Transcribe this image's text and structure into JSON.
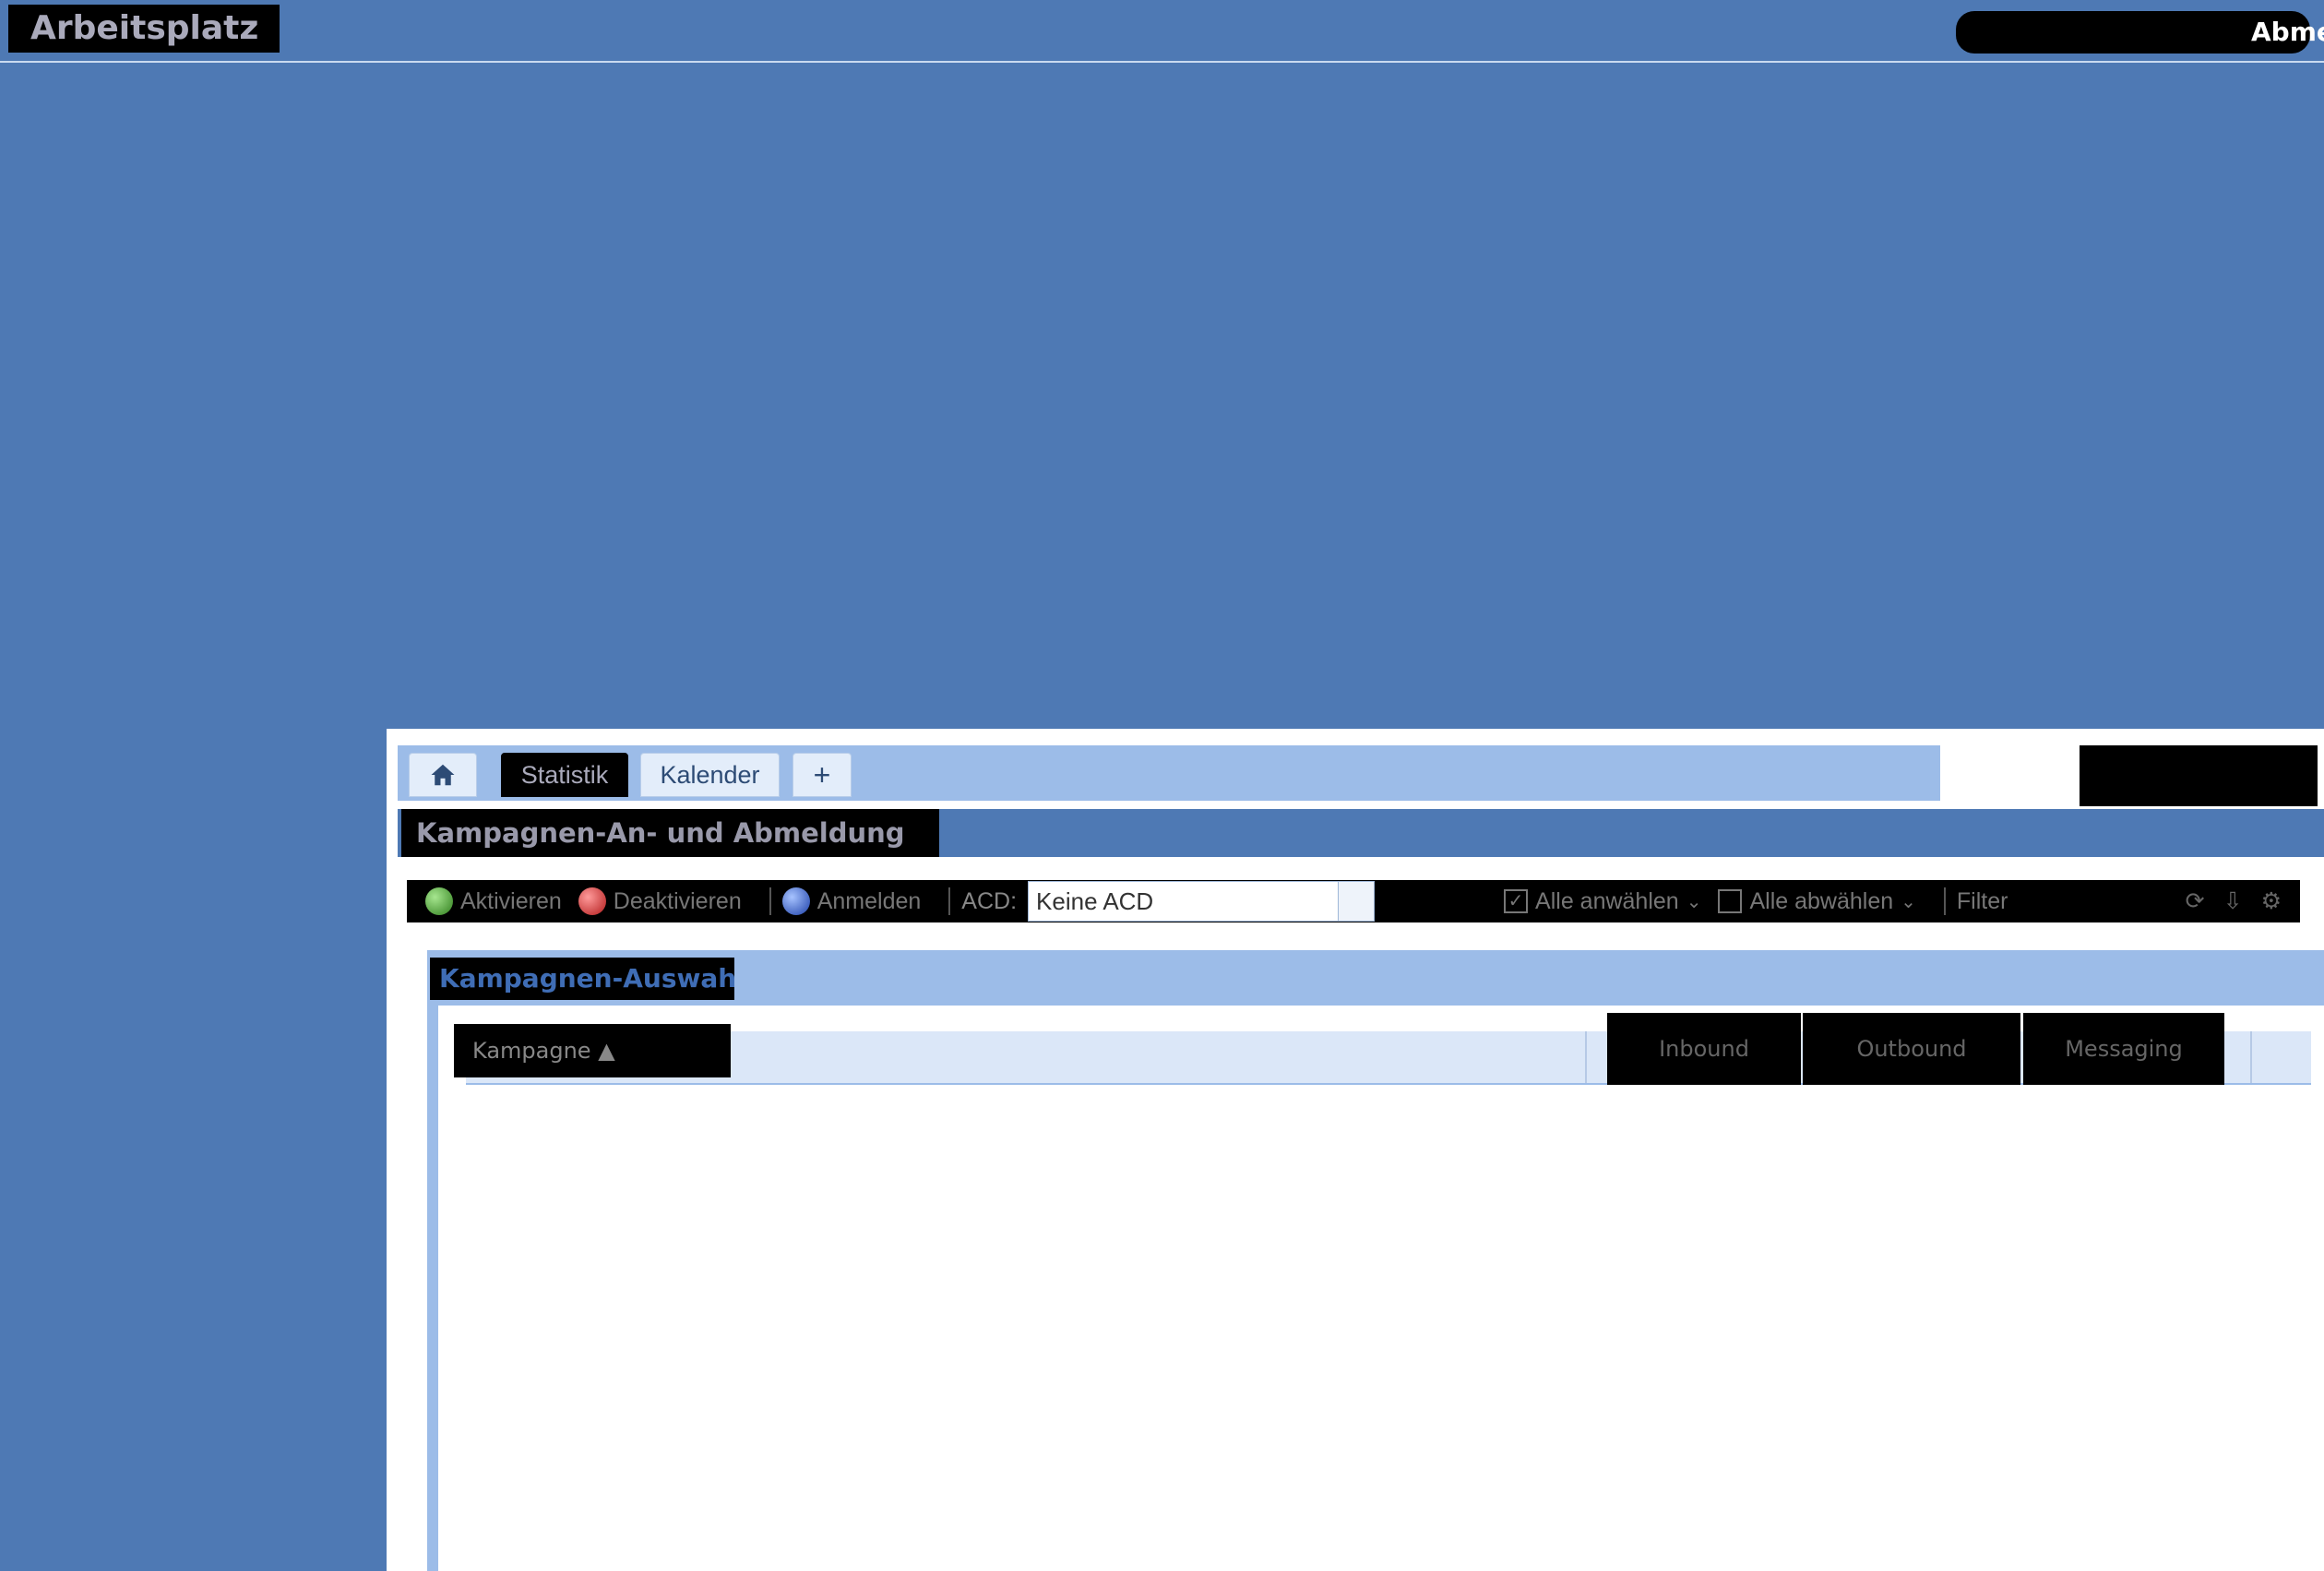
{
  "header": {
    "app_title": "Arbeitsplatz",
    "logout_label": "Abmelden"
  },
  "tabs": {
    "statistik": "Statistik",
    "kalender": "Kalender",
    "add": "+"
  },
  "panel": {
    "title": "Kampagnen-An- und Abmeldung"
  },
  "toolbar": {
    "aktivieren": "Aktivieren",
    "deaktivieren": "Deaktivieren",
    "anmelden": "Anmelden",
    "acd_label": "ACD:",
    "acd_value": "Keine ACD",
    "alle_anwaehlen": "Alle anwählen",
    "alle_abwaehlen": "Alle abwählen",
    "filter": "Filter"
  },
  "section": {
    "title": "Kampagnen-Auswahl"
  },
  "grid": {
    "columns": [
      "Kampagne",
      "Inbound",
      "Outbound",
      "Messaging"
    ]
  }
}
